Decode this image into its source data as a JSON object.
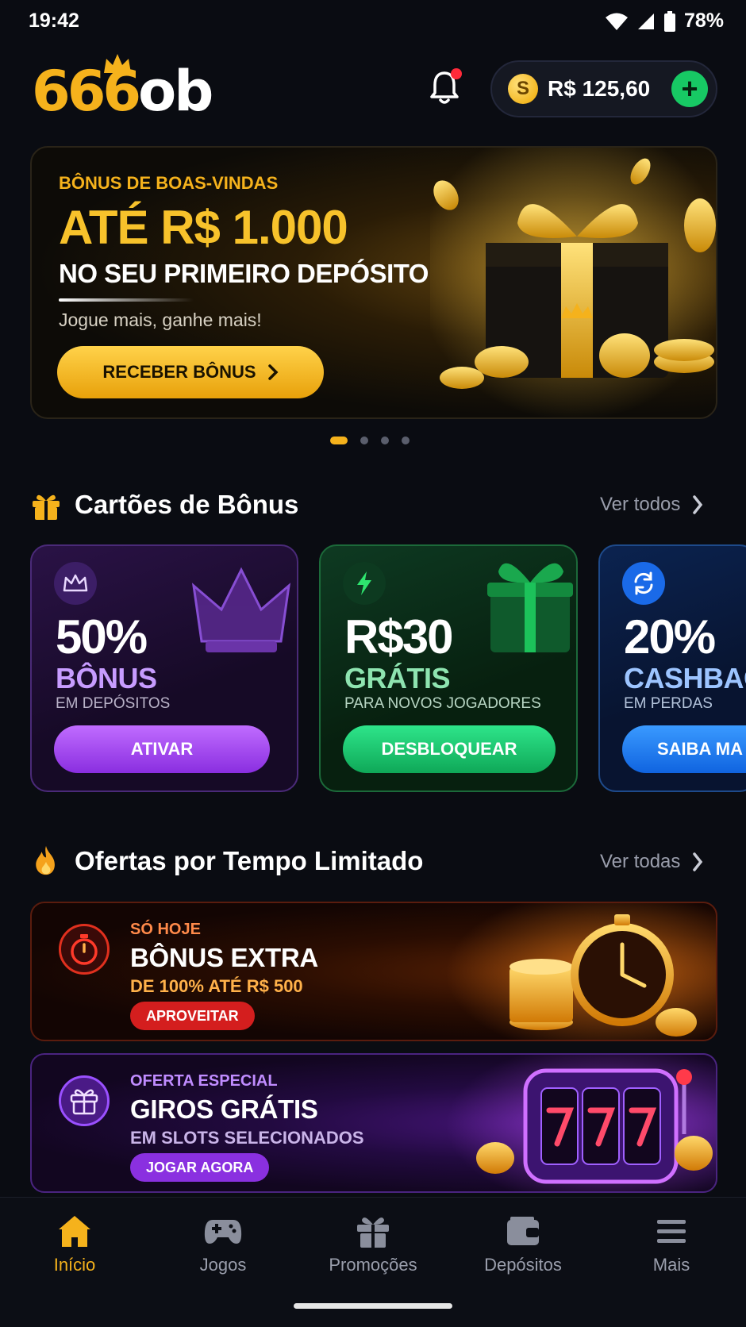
{
  "status_bar": {
    "time": "19:42",
    "battery": "78%"
  },
  "header": {
    "logo_666": "666",
    "logo_ob": "ob",
    "balance": "R$ 125,60",
    "coin_symbol": "S",
    "add_symbol": "+"
  },
  "hero": {
    "eyebrow": "BÔNUS DE BOAS-VINDAS",
    "title": "ATÉ R$ 1.000",
    "subtitle": "NO SEU PRIMEIRO DEPÓSITO",
    "note": "Jogue mais, ganhe mais!",
    "button": "RECEBER BÔNUS",
    "carousel_count": 4,
    "carousel_active": 0
  },
  "bonus_section": {
    "title": "Cartões de Bônus",
    "see_all": "Ver todos",
    "cards": [
      {
        "big": "50%",
        "mid": "BÔNUS",
        "small": "EM DEPÓSITOS",
        "button": "ATIVAR",
        "icon": "crown-icon",
        "accent": "#b07cf0"
      },
      {
        "big": "R$30",
        "mid": "GRÁTIS",
        "small": "PARA NOVOS JOGADORES",
        "button": "DESBLOQUEAR",
        "icon": "lightning-icon",
        "accent": "#7de0a6"
      },
      {
        "big": "20%",
        "mid": "CASHBAC",
        "small": "EM PERDAS",
        "button": "SAIBA MA",
        "icon": "refresh-icon",
        "accent": "#8ab8ff"
      }
    ]
  },
  "offers_section": {
    "title": "Ofertas por Tempo Limitado",
    "see_all": "Ver todas",
    "offers": [
      {
        "eyebrow": "SÓ HOJE",
        "title": "BÔNUS EXTRA",
        "subtitle": "DE 100% ATÉ R$ 500",
        "button": "APROVEITAR",
        "icon": "stopwatch-icon"
      },
      {
        "eyebrow": "OFERTA ESPECIAL",
        "title": "GIROS GRÁTIS",
        "subtitle": "EM SLOTS SELECIONADOS",
        "button": "JOGAR AGORA",
        "icon": "gift-icon"
      }
    ]
  },
  "nav": {
    "items": [
      {
        "label": "Início",
        "icon": "home-icon",
        "active": true
      },
      {
        "label": "Jogos",
        "icon": "gamepad-icon"
      },
      {
        "label": "Promoções",
        "icon": "gift-icon"
      },
      {
        "label": "Depósitos",
        "icon": "wallet-icon"
      },
      {
        "label": "Mais",
        "icon": "menu-icon"
      }
    ]
  },
  "colors": {
    "gold": "#f5b21c",
    "green": "#17c964",
    "background": "#0a0c12"
  }
}
